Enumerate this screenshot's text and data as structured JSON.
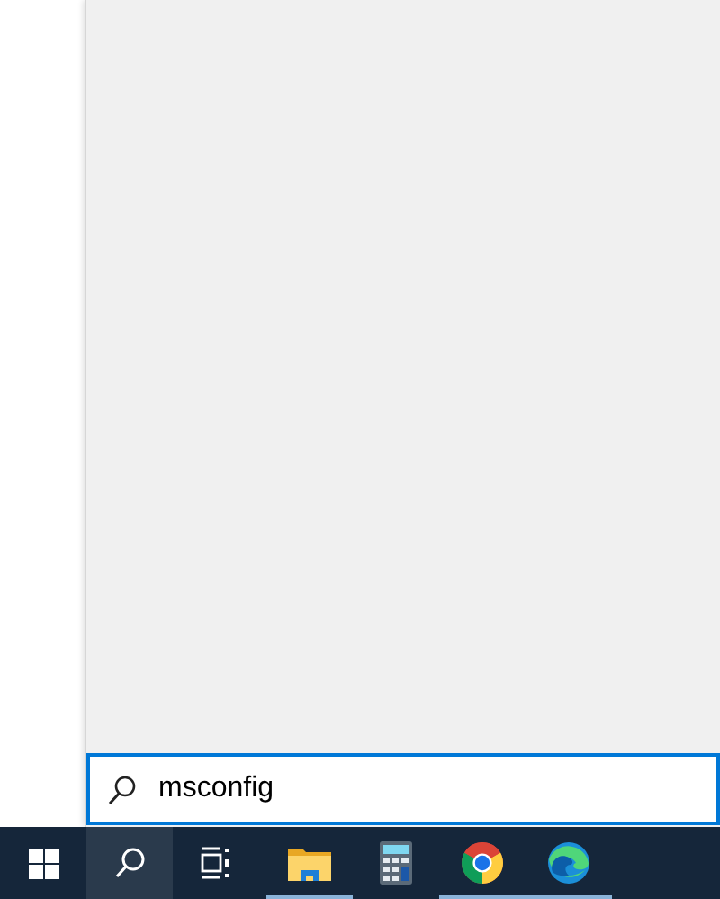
{
  "search": {
    "value": "msconfig"
  },
  "taskbar": [
    {
      "kind": "start",
      "active": false,
      "running": false
    },
    {
      "kind": "search",
      "active": true,
      "running": false
    },
    {
      "kind": "taskview",
      "active": false,
      "running": false
    },
    {
      "kind": "folder",
      "active": false,
      "running": true
    },
    {
      "kind": "calculator",
      "active": false,
      "running": false
    },
    {
      "kind": "chrome",
      "active": false,
      "running": true
    },
    {
      "kind": "edge",
      "active": false,
      "running": true
    }
  ]
}
